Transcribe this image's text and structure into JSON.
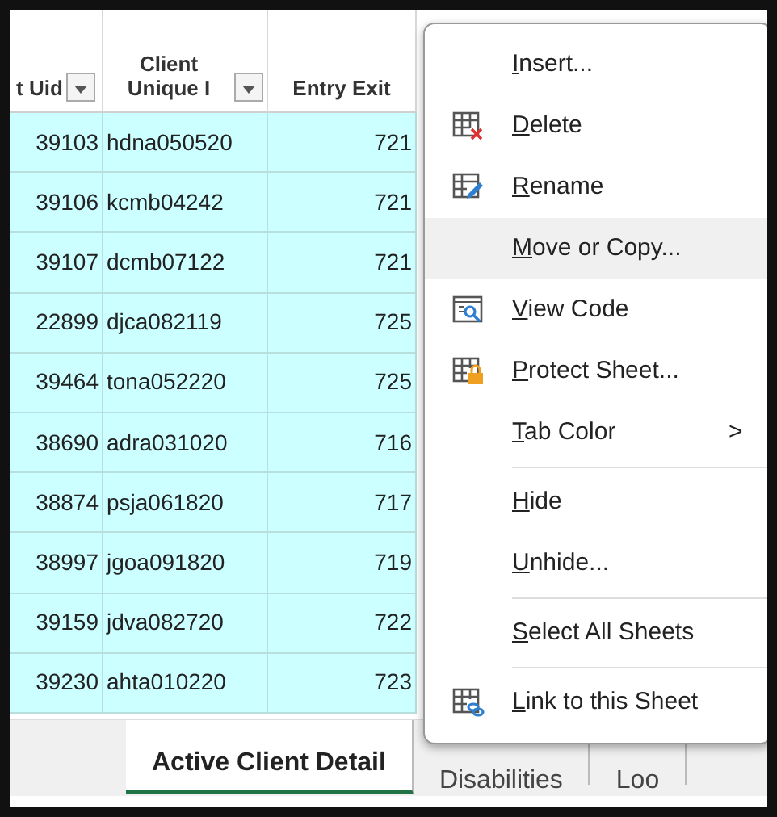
{
  "table": {
    "columns": [
      {
        "label": "t Uid",
        "filter": true
      },
      {
        "label": "Client Unique I",
        "filter": true
      },
      {
        "label": "Entry Exit"
      }
    ],
    "rows": [
      [
        "39103",
        "hdna050520",
        "721"
      ],
      [
        "39106",
        "kcmb04242",
        "721"
      ],
      [
        "39107",
        "dcmb07122",
        "721"
      ],
      [
        "22899",
        "djca082119",
        "725"
      ],
      [
        "39464",
        "tona052220",
        "725"
      ],
      [
        "38690",
        "adra031020",
        "716"
      ],
      [
        "38874",
        "psja061820",
        "717"
      ],
      [
        "38997",
        "jgoa091820",
        "719"
      ],
      [
        "39159",
        "jdva082720",
        "722"
      ],
      [
        "39230",
        "ahta010220",
        "723"
      ]
    ]
  },
  "sheet_tabs": [
    {
      "label": "Active Client Detail",
      "selected": true
    },
    {
      "label": "Disabilities",
      "selected": false
    },
    {
      "label": "Loo",
      "selected": false
    }
  ],
  "context_menu": [
    {
      "kind": "item",
      "label": "Insert...",
      "selected": false
    },
    {
      "kind": "item",
      "label": "Delete",
      "selected": false
    },
    {
      "kind": "item",
      "label": "Rename",
      "selected": false
    },
    {
      "kind": "item",
      "label": "Move or Copy...",
      "selected": true
    },
    {
      "kind": "item",
      "label": "View Code",
      "selected": false
    },
    {
      "kind": "item",
      "label": "Protect Sheet...",
      "selected": false
    },
    {
      "kind": "item",
      "label": "Tab Color",
      "selected": false,
      "submenu": ">"
    },
    {
      "kind": "separator"
    },
    {
      "kind": "item",
      "label": "Hide",
      "selected": false
    },
    {
      "kind": "item",
      "label": "Unhide...",
      "selected": false
    },
    {
      "kind": "separator"
    },
    {
      "kind": "item",
      "label": "Select All Sheets",
      "selected": false
    },
    {
      "kind": "separator"
    },
    {
      "kind": "item",
      "label": "Link to this Sheet",
      "selected": false
    }
  ]
}
